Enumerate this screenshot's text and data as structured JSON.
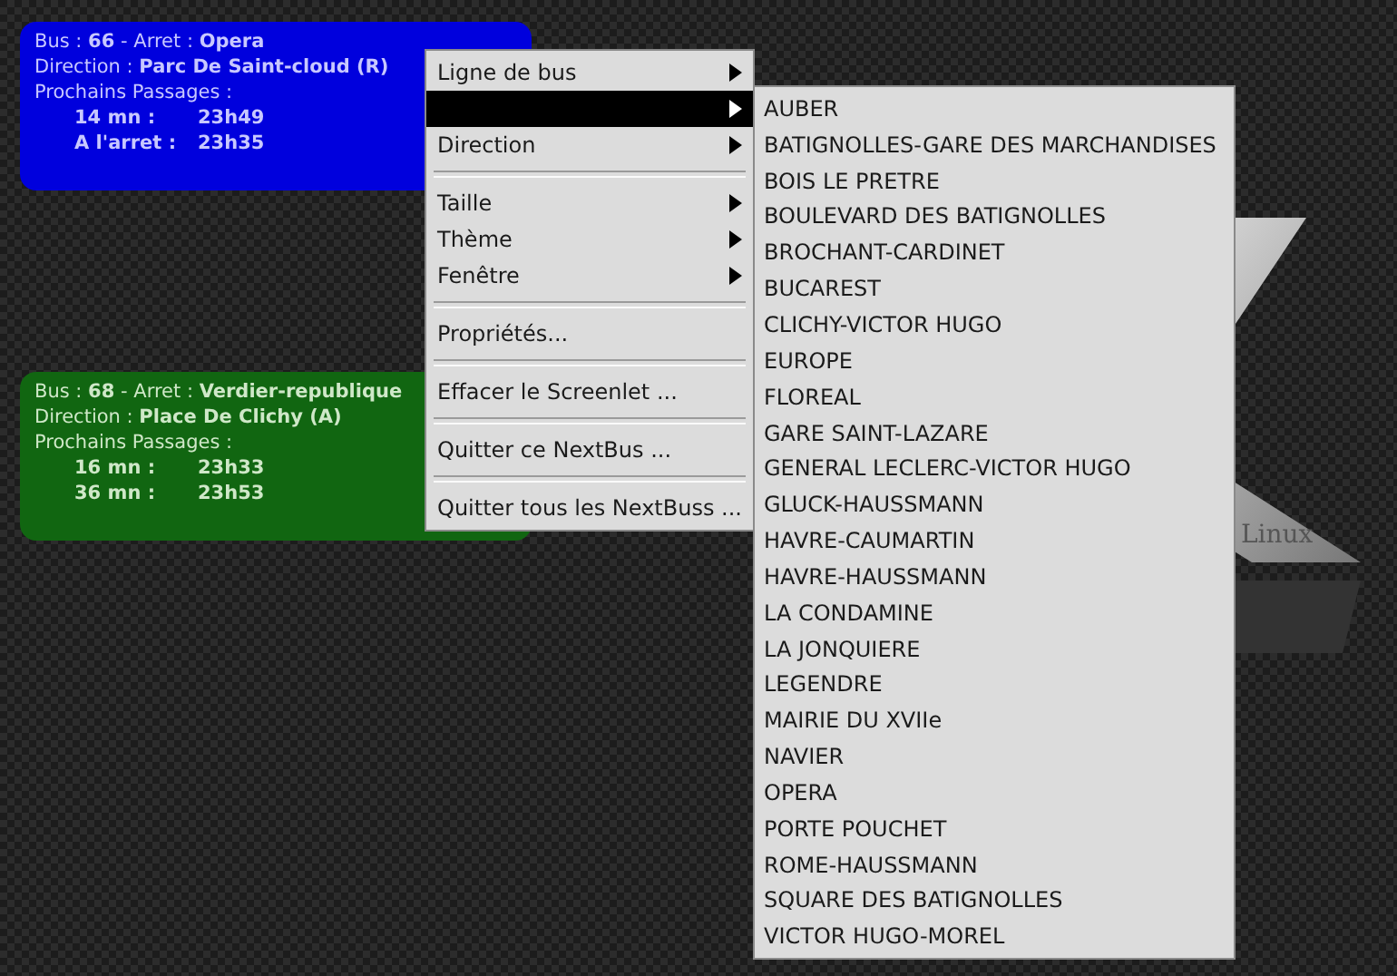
{
  "widgets": [
    {
      "color": "#0000dd",
      "bus_line": "Bus : **66** - Arret : **Opera**",
      "direction": "Direction : **Parc De Saint-cloud (R)**",
      "passages_label": "Prochains Passages :",
      "passages": [
        {
          "label": "14 mn :",
          "time": "23h49"
        },
        {
          "label": "A l'arret :",
          "time": "23h35"
        }
      ]
    },
    {
      "color": "#116611",
      "bus_line": "Bus : **68** - Arret : **Verdier-republique**",
      "direction": "Direction : **Place De Clichy (A)**",
      "passages_label": "Prochains Passages :",
      "passages": [
        {
          "label": "16 mn :",
          "time": "23h33"
        },
        {
          "label": "36 mn :",
          "time": "23h53"
        }
      ]
    }
  ],
  "wallpaper": {
    "caption": "Linux"
  },
  "context_menu": {
    "items": [
      {
        "kind": "item",
        "label": "Ligne de bus",
        "submenu": true,
        "selected": false
      },
      {
        "kind": "item",
        "submenu": true,
        "selected": true
      },
      {
        "kind": "item",
        "label": "Direction",
        "submenu": true,
        "selected": false
      },
      {
        "kind": "separator"
      },
      {
        "kind": "item",
        "label": "Taille",
        "submenu": true,
        "selected": false
      },
      {
        "kind": "item",
        "label": "Thème",
        "submenu": true,
        "selected": false
      },
      {
        "kind": "item",
        "label": "Fenêtre",
        "submenu": true,
        "selected": false
      },
      {
        "kind": "separator"
      },
      {
        "kind": "item",
        "label": "Propriétés...",
        "submenu": false,
        "selected": false
      },
      {
        "kind": "separator"
      },
      {
        "kind": "item",
        "label": "Effacer le Screenlet ...",
        "submenu": false,
        "selected": false
      },
      {
        "kind": "separator"
      },
      {
        "kind": "item",
        "label": "Quitter ce NextBus ...",
        "submenu": false,
        "selected": false
      },
      {
        "kind": "separator"
      },
      {
        "kind": "item",
        "label": "Quitter tous les NextBuss ...",
        "submenu": false,
        "selected": false
      }
    ]
  },
  "submenu": {
    "items": [
      "AUBER",
      "BATIGNOLLES-GARE DES MARCHANDISES",
      "BOIS LE PRETRE",
      "BOULEVARD DES BATIGNOLLES",
      "BROCHANT-CARDINET",
      "BUCAREST",
      "CLICHY-VICTOR HUGO",
      "EUROPE",
      "FLOREAL",
      "GARE SAINT-LAZARE",
      "GENERAL LECLERC-VICTOR HUGO",
      "GLUCK-HAUSSMANN",
      "HAVRE-CAUMARTIN",
      "HAVRE-HAUSSMANN",
      "LA CONDAMINE",
      "LA JONQUIERE",
      "LEGENDRE",
      "MAIRIE DU XVIIe",
      "NAVIER",
      "OPERA",
      "PORTE POUCHET",
      "ROME-HAUSSMANN",
      "SQUARE DES BATIGNOLLES",
      "VICTOR HUGO-MOREL"
    ]
  }
}
